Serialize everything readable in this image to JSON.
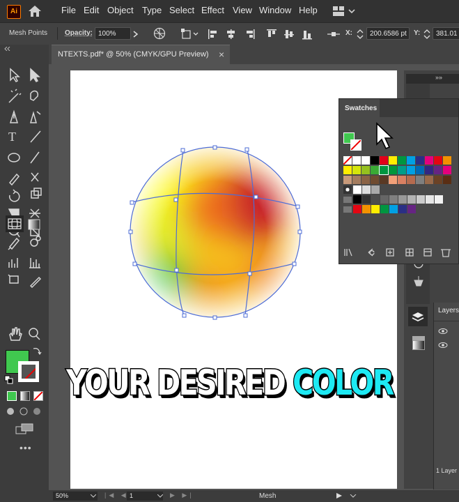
{
  "app": {
    "logo": "Ai"
  },
  "menu": [
    "File",
    "Edit",
    "Object",
    "Type",
    "Select",
    "Effect",
    "View",
    "Window",
    "Help"
  ],
  "control": {
    "tool_name": "Mesh Points",
    "opacity_label": "Opacity:",
    "opacity_value": "100%",
    "x_label": "X:",
    "x_value": "200.6586 pt",
    "y_label": "Y:",
    "y_value": "381.01"
  },
  "document": {
    "tab_title": "NTEXTS.pdf* @ 50% (CMYK/GPU Preview)",
    "close": "×"
  },
  "swatches": {
    "title": "Swatches",
    "rows": [
      [
        "none",
        "#ffffff",
        "#ffffff",
        "#000000",
        "#e2001a",
        "#ffed00",
        "#009640",
        "#00a0e3",
        "#2a2f85",
        "#e5007e",
        "#e30613",
        "#f39200"
      ],
      [
        "#ffed00",
        "#d5e60c",
        "#95c11f",
        "#3aaa35",
        "#009640",
        "#00973b",
        "#009e89",
        "#00a0e3",
        "#0069b4",
        "#312783",
        "#662483",
        "#e4007d"
      ],
      [
        "#c89a7a",
        "#a47c5e",
        "#8a6244",
        "#6f4b30",
        "#5a3924",
        "#f2a078",
        "#d98062",
        "#b56b4f",
        "#7f7f7f",
        "#996a4b",
        "#6b4226",
        "#5a2e14"
      ],
      [
        "#ffffff",
        "#dddddd",
        "#aaaaaa"
      ],
      [
        "#000000",
        "#333333",
        "#4d4d4d",
        "#666666",
        "#808080",
        "#999999",
        "#b3b3b3",
        "#cccccc",
        "#e6e6e6",
        "#f2f2f2"
      ],
      [
        "#e30613",
        "#f39200",
        "#ffed00",
        "#009640",
        "#00a0e3",
        "#2a2f85",
        "#662483"
      ]
    ]
  },
  "layers": {
    "title": "Layers",
    "count": "1 Layer"
  },
  "status": {
    "zoom": "50%",
    "page": "1",
    "tool": "Mesh"
  },
  "caption": {
    "part1": "YOUR DESIRED ",
    "part2": "COLOR",
    "accent": "#1de9f3"
  },
  "colors": {
    "fill": "#40c84f",
    "menubar": "#323232",
    "panel": "#424242",
    "canvas": "#535353"
  }
}
